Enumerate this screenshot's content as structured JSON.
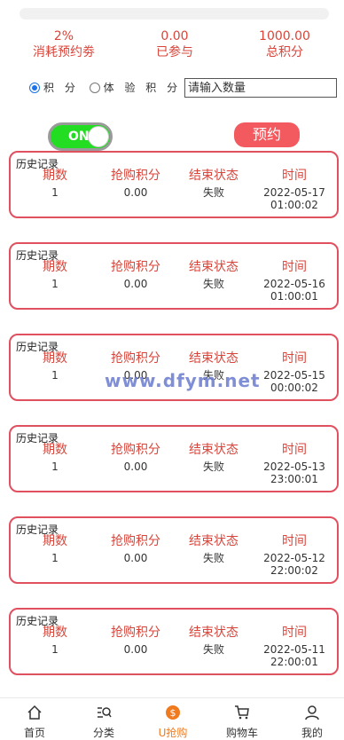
{
  "stats": [
    {
      "value": "2%",
      "label": "消耗预约劵"
    },
    {
      "value": "0.00",
      "label": "已参与"
    },
    {
      "value": "1000.00",
      "label": "总积分"
    }
  ],
  "options": {
    "radio1": "积 分",
    "radio2": "体 验 积 分",
    "selected": "积 分",
    "quantity_placeholder": "请输入数量"
  },
  "toggle": {
    "label": "ON",
    "state": "on"
  },
  "reserve_label": "预约",
  "records_title": "历史记录",
  "records_headers": {
    "period": "期数",
    "points": "抢购积分",
    "status": "结束状态",
    "time": "时间"
  },
  "records": [
    {
      "period": "1",
      "points": "0.00",
      "status": "失败",
      "time": "2022-05-17\n01:00:02"
    },
    {
      "period": "1",
      "points": "0.00",
      "status": "失败",
      "time": "2022-05-16\n01:00:01"
    },
    {
      "period": "1",
      "points": "0.00",
      "status": "失败",
      "time": "2022-05-15\n00:00:02"
    },
    {
      "period": "1",
      "points": "0.00",
      "status": "失败",
      "time": "2022-05-13\n23:00:01"
    },
    {
      "period": "1",
      "points": "0.00",
      "status": "失败",
      "time": "2022-05-12\n22:00:02"
    },
    {
      "period": "1",
      "points": "0.00",
      "status": "失败",
      "time": "2022-05-11\n22:00:01"
    }
  ],
  "watermark": "www.dfym.net",
  "tabbar": [
    {
      "label": "首页",
      "icon": "home-icon"
    },
    {
      "label": "分类",
      "icon": "category-search-icon"
    },
    {
      "label": "U抢购",
      "icon": "coin-icon",
      "active": true
    },
    {
      "label": "购物车",
      "icon": "cart-icon"
    },
    {
      "label": "我的",
      "icon": "user-icon"
    }
  ],
  "colors": {
    "accent_red": "#d9453a",
    "card_border": "#e0505f",
    "button": "#f25a5f",
    "toggle_on": "#22dd22",
    "tab_active": "#f07b1f"
  }
}
